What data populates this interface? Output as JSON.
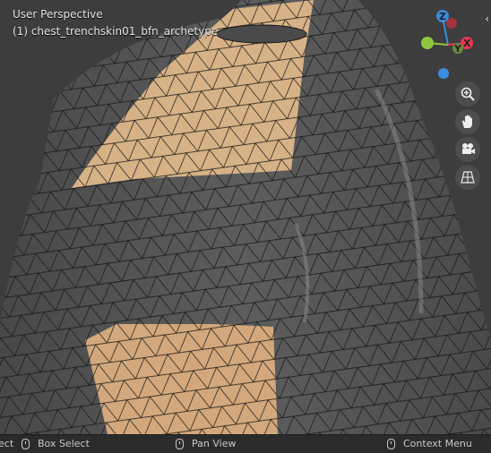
{
  "viewport": {
    "view_name": "User Perspective",
    "object_label": "(1) chest_trenchskin01_bfn_archetype"
  },
  "gizmo": {
    "z_label": "Z",
    "y_label": "Y",
    "x_label": "X",
    "colors": {
      "x": "#e8394f",
      "y": "#8ec73e",
      "z": "#3a8dde"
    }
  },
  "nav_buttons": [
    "zoom-icon",
    "pan-hand-icon",
    "camera-icon",
    "perspective-grid-icon"
  ],
  "statusbar": {
    "left_partial": "ect",
    "box_select": "Box Select",
    "pan_view": "Pan View",
    "context_menu": "Context Menu"
  },
  "colors": {
    "skin": "#d7b287",
    "garment": "#5a5a5a",
    "background": "#3d3d3d",
    "wire": "#1a1a1a"
  }
}
